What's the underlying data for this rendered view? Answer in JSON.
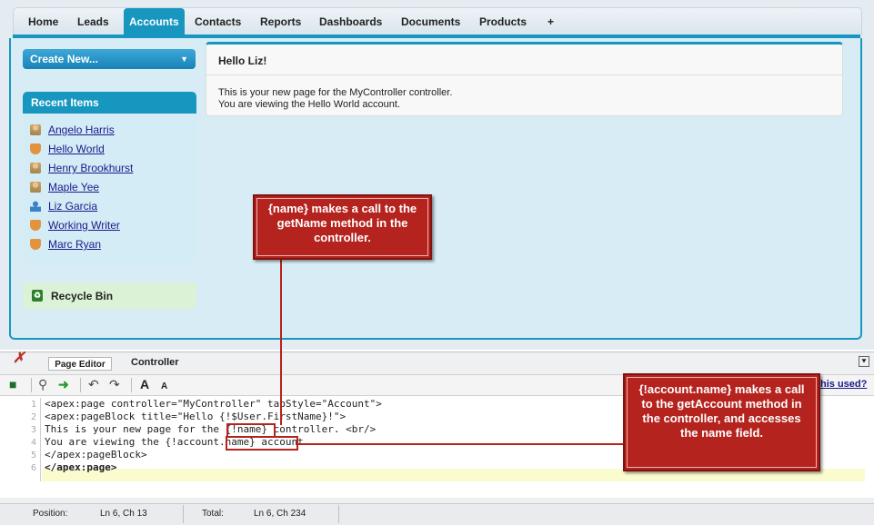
{
  "nav": {
    "tabs": [
      "Home",
      "Leads",
      "Accounts",
      "Contacts",
      "Reports",
      "Dashboards",
      "Documents",
      "Products",
      "+"
    ],
    "active_tab": "Accounts"
  },
  "sidebar": {
    "create_new": "Create New...",
    "recent_title": "Recent Items",
    "recent_items": [
      {
        "label": "Angelo Harris",
        "icon": "contact-icon"
      },
      {
        "label": "Hello World",
        "icon": "account-icon"
      },
      {
        "label": "Henry Brookhurst",
        "icon": "contact-icon"
      },
      {
        "label": "Maple Yee",
        "icon": "contact-icon"
      },
      {
        "label": "Liz Garcia",
        "icon": "user-icon"
      },
      {
        "label": "Working Writer",
        "icon": "account-icon"
      },
      {
        "label": "Marc Ryan",
        "icon": "account-icon"
      }
    ],
    "recycle_bin": "Recycle Bin"
  },
  "main": {
    "title": "Hello Liz!",
    "line1": "This is your new page for the MyController controller.",
    "line2": "You are viewing the Hello World account."
  },
  "dev": {
    "tabs": [
      "Page Editor",
      "Controller"
    ],
    "help_link": "his used?",
    "toolbar_font_large": "A",
    "toolbar_font_small": "A",
    "code_lines": [
      "<apex:page controller=\"MyController\" tabStyle=\"Account\">",
      "<apex:pageBlock title=\"Hello {!$User.FirstName}!\">",
      "This is your new page for the {!name} controller. <br/>",
      "You are viewing the {!account.name} account.",
      "</apex:pageBlock>",
      "</apex:page>"
    ],
    "line_numbers": [
      "1",
      "2",
      "3",
      "4",
      "5",
      "6"
    ],
    "status": {
      "position_label": "Position:",
      "position_value": "Ln 6, Ch 13",
      "total_label": "Total:",
      "total_value": "Ln 6, Ch 234"
    }
  },
  "callouts": {
    "name": "{name} makes a call to the getName method in the controller.",
    "account": "{!account.name} makes a call to the getAccount method in the controller, and accesses the name field."
  }
}
